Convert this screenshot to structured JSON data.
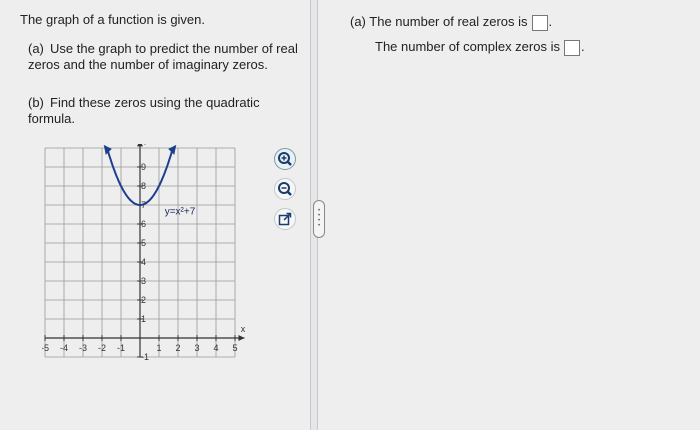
{
  "prompt": "The graph of a function is given.",
  "questions": {
    "a_label": "(a)",
    "a_text": "Use the graph to predict the number of real zeros and the number of imaginary zeros.",
    "b_label": "(b)",
    "b_text": "Find these zeros using the quadratic formula."
  },
  "graph": {
    "function_label": "y=x²+7",
    "y_axis_label": "y",
    "x_axis_label": "x",
    "x_ticks": [
      "-5",
      "-4",
      "-3",
      "-2",
      "-1",
      "1",
      "2",
      "3",
      "4",
      "5"
    ],
    "y_ticks": [
      "9",
      "8",
      "7",
      "6",
      "5",
      "4",
      "3",
      "2",
      "1",
      "-1"
    ]
  },
  "tools": [
    {
      "icon": "zoom-in-icon"
    },
    {
      "icon": "zoom-out-icon"
    },
    {
      "icon": "external-link-icon"
    }
  ],
  "answers": {
    "a_label": "(a)",
    "real_zeros_text": "The number of real zeros is",
    "complex_zeros_text": "The number of complex zeros is",
    "real_zeros_value": "",
    "complex_zeros_value": ""
  },
  "colors": {
    "background": "#eeeeef",
    "curve": "#1c3f8c",
    "grid": "#999999"
  }
}
